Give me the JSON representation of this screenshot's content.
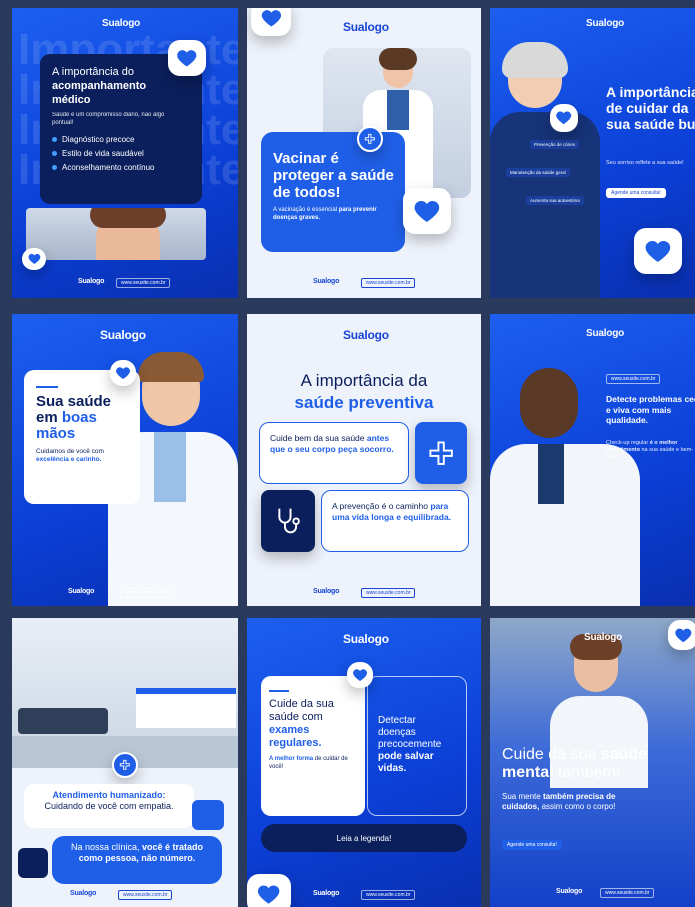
{
  "brand": {
    "logo": "Sualogo",
    "url": "www.seusite.com.br"
  },
  "colors": {
    "primary": "#1f5fe8",
    "navy": "#0b1f5c",
    "accent": "#3fa0ff"
  },
  "tile1": {
    "title_pre": "A importância do",
    "title_strong": "acompanhamento médico",
    "subtitle": "Saúde é um compromisso diário, não algo pontual!",
    "bullets": [
      "Diagnóstico precoce",
      "Estilo de vida saudável",
      "Aconselhamento contínuo"
    ],
    "bg_word": "Importante"
  },
  "tile2": {
    "title": "Vacinar é proteger a saúde de todos!",
    "sub_pre": "A vacinação é essencial",
    "sub_strong": "para prevenir doenças graves."
  },
  "tile3": {
    "title": "A importância de cuidar da sua saúde bucal",
    "sub": "Seu sorriso reflete a sua saúde!",
    "button": "Agende uma consulta!",
    "chips": [
      "Prevenção de cáries",
      "Manutenção da saúde geral",
      "Aumenta sua autoestima"
    ]
  },
  "tile4": {
    "title_1": "Sua saúde",
    "title_2": "em",
    "title_3": "boas mãos",
    "sub_pre": "Cuidamos de você com",
    "sub_strong": "excelência e carinho."
  },
  "tile5": {
    "title_1": "A importância da",
    "title_2": "saúde preventiva",
    "card1_pre": "Cuide bem da sua saúde",
    "card1_strong": "antes que o seu corpo peça socorro.",
    "card2_pre": "A prevenção é o caminho",
    "card2_strong": "para uma vida longa e equilibrada."
  },
  "tile6": {
    "title_a": "Detecte problemas",
    "title_b": "cedo e",
    "title_c": "viva com mais qualidade.",
    "sub_pre": "Check-up regular",
    "sub_strong": "é o melhor investimento",
    "sub_post": "na sua saúde e bem-estar."
  },
  "tile7": {
    "card1_strong": "Atendimento humanizado:",
    "card1_text": "Cuidando de você com empatia.",
    "card2_pre": "Na nossa clínica,",
    "card2_strong": "você é tratado como pessoa, não número."
  },
  "tile8": {
    "left_pre": "Cuide da sua saúde com",
    "left_strong": "exames regulares.",
    "left_sub_strong": "A melhor forma",
    "left_sub": "de cuidar de você!",
    "right_pre": "Detectar doenças precocemente",
    "right_strong": "pode salvar vidas.",
    "button": "Leia a legenda!"
  },
  "tile9": {
    "title_pre": "Cuide da sua",
    "title_strong_1": "saúde",
    "title_strong_2": "mental",
    "title_post": "também!",
    "sub_pre": "Sua mente",
    "sub_strong": "também precisa de cuidados,",
    "sub_post": "assim como o corpo!",
    "button": "Agende uma consulta!"
  }
}
